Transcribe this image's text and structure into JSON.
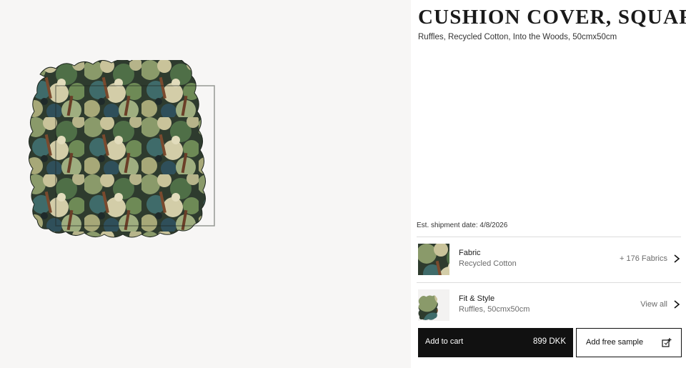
{
  "product": {
    "title": "CUSHION COVER, SQUARE",
    "subtitle": "Ruffles, Recycled Cotton, Into the Woods, 50cmx50cm",
    "shipment": "Est. shipment date: 4/8/2026",
    "image_icon": "forest-print-cushion-image"
  },
  "options": [
    {
      "label": "Fabric",
      "value": "Recycled Cotton",
      "meta": "+ 176 Fabrics",
      "icon": "chevron-right-icon"
    },
    {
      "label": "Fit & Style",
      "value": "Ruffles, 50cmx50cm",
      "meta": "View all",
      "icon": "chevron-right-icon"
    }
  ],
  "actions": {
    "cart_label": "Add to cart",
    "price": "899 DKK",
    "sample_label": "Add free sample",
    "sample_icon": "sample-swatch-plus-icon"
  },
  "colors": {
    "cart_bg": "#111111",
    "gallery_bg": "#f7f6f5",
    "muted_text": "#6b6b6b",
    "divider": "#dcdcdc"
  }
}
